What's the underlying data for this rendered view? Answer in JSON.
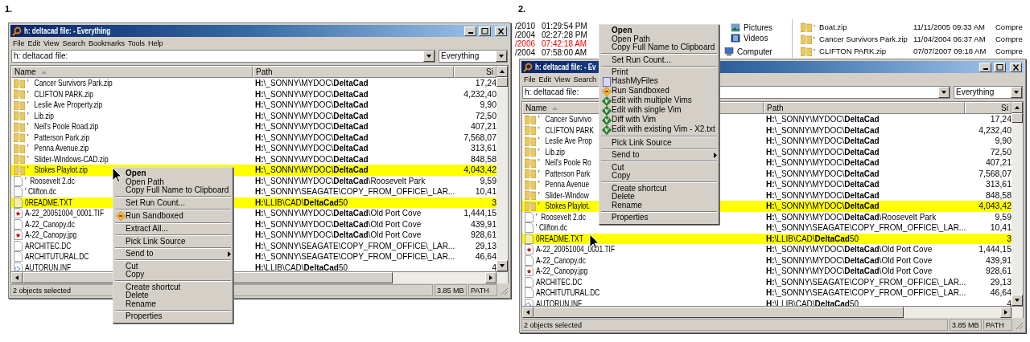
{
  "panels": [
    {
      "label": "1.",
      "window": {
        "title": "h: deltacad file: - Everything",
        "menu": [
          "File",
          "Edit",
          "View",
          "Search",
          "Bookmarks",
          "Tools",
          "Help"
        ],
        "search": {
          "value": "h: deltacad file:"
        },
        "filter": "Everything",
        "columns": [
          "Name",
          "Path",
          "Si"
        ],
        "rows": [
          {
            "kind": "zip",
            "name": "'   Cancer Survivors Park.zip",
            "path": "**H:**\\_SONNY\\MYDOC\\**DeltaCad**",
            "size": "17,24",
            "selected": false
          },
          {
            "kind": "zip",
            "name": "'   CLIFTON PARK.zip",
            "path": "**H:**\\_SONNY\\MYDOC\\**DeltaCad**",
            "size": "4,232,40",
            "selected": false
          },
          {
            "kind": "zip",
            "name": "'   Leslie Ave Property.zip",
            "path": "**H:**\\_SONNY\\MYDOC\\**DeltaCad**",
            "size": "9,90",
            "selected": false
          },
          {
            "kind": "zip",
            "name": "'   Lib.zip",
            "path": "**H:**\\_SONNY\\MYDOC\\**DeltaCad**",
            "size": "72,50",
            "selected": false
          },
          {
            "kind": "zip",
            "name": "'   Neil's Poole Road.zip",
            "path": "**H:**\\_SONNY\\MYDOC\\**DeltaCad**",
            "size": "407,21",
            "selected": false
          },
          {
            "kind": "zip",
            "name": "'   Patterson Park.zip",
            "path": "**H:**\\_SONNY\\MYDOC\\**DeltaCad**",
            "size": "7,568,07",
            "selected": false
          },
          {
            "kind": "zip",
            "name": "'   Penna Avenue.zip",
            "path": "**H:**\\_SONNY\\MYDOC\\**DeltaCad**",
            "size": "313,61",
            "selected": false
          },
          {
            "kind": "zip",
            "name": "'   Slider-Windows-CAD.zip",
            "path": "**H:**\\_SONNY\\MYDOC\\**DeltaCad**",
            "size": "848,58",
            "selected": false
          },
          {
            "kind": "zip",
            "name": "'   Stokes Playlot.zip",
            "path": "**H:**\\_SONNY\\MYDOC\\**DeltaCad**",
            "size": "4,043,42",
            "selected": true
          },
          {
            "kind": "doc",
            "name": "'  Roosevelt 2.dc",
            "path": "**H:**\\_SONNY\\MYDOC\\**DeltaCad**\\Roosevelt Park",
            "size": "9,59",
            "selected": false
          },
          {
            "kind": "doc",
            "name": "' Clifton.dc",
            "path": "**H:**\\_SONNY\\SEAGATE\\COPY_FROM_OFFICE\\_LAR...",
            "size": "10,41",
            "selected": false
          },
          {
            "kind": "text",
            "name": "0README.TXT",
            "path": "**H:**\\LLIB\\CAD\\**DeltaCad**50",
            "size": "3",
            "selected": true
          },
          {
            "kind": "image",
            "name": "A-22_20051004_0001.TIF",
            "path": "**H:**\\_SONNY\\MYDOC\\**DeltaCad**\\Old Port Cove",
            "size": "1,444,15",
            "selected": false
          },
          {
            "kind": "doc",
            "name": "A-22_Canopy.dc",
            "path": "**H:**\\_SONNY\\MYDOC\\**DeltaCad**\\Old Port Cove",
            "size": "439,91",
            "selected": false
          },
          {
            "kind": "image",
            "name": "A-22_Canopy.jpg",
            "path": "**H:**\\_SONNY\\MYDOC\\**DeltaCad**\\Old Port Cove",
            "size": "928,61",
            "selected": false
          },
          {
            "kind": "doc",
            "name": "ARCHITEC.DC",
            "path": "**H:**\\_SONNY\\SEAGATE\\COPY_FROM_OFFICE\\_LAR...",
            "size": "29,13",
            "selected": false
          },
          {
            "kind": "doc",
            "name": "ARCHITUTURAL.DC",
            "path": "**H:**\\_SONNY\\SEAGATE\\COPY_FROM_OFFICE\\_LAR...",
            "size": "46,64",
            "selected": false
          },
          {
            "kind": "settings",
            "name": "AUTORUN.INF",
            "path": "**H:**\\LLIB\\CAD\\**DeltaCad**50",
            "size": "4",
            "selected": false
          }
        ],
        "status": [
          "2 objects selected",
          "3.85 MB",
          "PATH"
        ]
      },
      "context_menu": {
        "groups": [
          [
            {
              "label": "Open",
              "default": true
            },
            {
              "label": "Open Path",
              "default": false
            },
            {
              "label": "Copy Full Name to Clipboard",
              "default": false
            }
          ],
          [
            {
              "label": "Set Run Count...",
              "default": false
            }
          ],
          [
            {
              "label": "Run Sandboxed",
              "default": false,
              "kind": "sandbox"
            }
          ],
          [
            {
              "label": "Extract All...",
              "default": false
            }
          ],
          [
            {
              "label": "Pick Link Source",
              "default": false
            }
          ],
          [
            {
              "label": "Send to",
              "default": false,
              "submenu": true
            }
          ],
          [
            {
              "label": "Cut",
              "default": false
            },
            {
              "label": "Copy",
              "default": false
            }
          ],
          [
            {
              "label": "Create shortcut",
              "default": false
            },
            {
              "label": "Delete",
              "default": false
            },
            {
              "label": "Rename",
              "default": false
            }
          ],
          [
            {
              "label": "Properties",
              "default": false
            }
          ]
        ]
      }
    },
    {
      "label": "2.",
      "background": {
        "dates": [
          {
            "date": "/2010",
            "time": "01:29:54 PM",
            "color": "#000000"
          },
          {
            "date": "/2004",
            "time": "02:27:28 PM",
            "color": "#000000"
          },
          {
            "date": "/2006",
            "time": "07:42:18 AM",
            "color": "#ff0000"
          },
          {
            "date": "/2004",
            "time": "07:58:00 AM",
            "color": "#000000"
          }
        ],
        "places": [
          {
            "kind": "pictures",
            "label": "Pictures"
          },
          {
            "kind": "videos",
            "label": "Videos"
          },
          {
            "kind": "computer",
            "label": "Computer"
          }
        ],
        "files": [
          {
            "name": "'  Boat.zip",
            "date": "11/11/2005 09:33 AM",
            "type": "Compre"
          },
          {
            "name": "'  Cancer Survivors Park.zip",
            "date": "11/04/2004 06:37 AM",
            "type": "Compre"
          },
          {
            "name": "'  CLIFTON PARK.zip",
            "date": "07/07/2007 09:18 AM",
            "type": "Compre"
          }
        ]
      },
      "window": {
        "title": "h: deltacad file: - Ev",
        "menu": [
          "File",
          "Edit",
          "View",
          "Search"
        ],
        "search": {
          "value": "h: deltacad file:"
        },
        "filter": "Everything",
        "columns": [
          "Name",
          "Path",
          "Si"
        ],
        "rows": [
          {
            "kind": "zip",
            "name": "'   Cancer Survivo",
            "path": "**H:**\\_SONNY\\MYDOC\\**DeltaCad**",
            "size": "17,24",
            "selected": false
          },
          {
            "kind": "zip",
            "name": "'   CLIFTON PARK",
            "path": "**H:**\\_SONNY\\MYDOC\\**DeltaCad**",
            "size": "4,232,40",
            "selected": false
          },
          {
            "kind": "zip",
            "name": "'   Leslie Ave Prop",
            "path": "**H:**\\_SONNY\\MYDOC\\**DeltaCad**",
            "size": "9,90",
            "selected": false
          },
          {
            "kind": "zip",
            "name": "'   Lib.zip",
            "path": "**H:**\\_SONNY\\MYDOC\\**DeltaCad**",
            "size": "72,50",
            "selected": false
          },
          {
            "kind": "zip",
            "name": "'   Neil's Poole Ro",
            "path": "**H:**\\_SONNY\\MYDOC\\**DeltaCad**",
            "size": "407,21",
            "selected": false
          },
          {
            "kind": "zip",
            "name": "'   Patterson Park",
            "path": "**H:**\\_SONNY\\MYDOC\\**DeltaCad**",
            "size": "7,568,07",
            "selected": false
          },
          {
            "kind": "zip",
            "name": "'   Penna Avenue",
            "path": "**H:**\\_SONNY\\MYDOC\\**DeltaCad**",
            "size": "313,61",
            "selected": false
          },
          {
            "kind": "zip",
            "name": "'   Slider-Window",
            "path": "**H:**\\_SONNY\\MYDOC\\**DeltaCad**",
            "size": "848,58",
            "selected": false
          },
          {
            "kind": "zip",
            "name": "'   Stokes Playlot.",
            "path": "**H:**\\_SONNY\\MYDOC\\**DeltaCad**",
            "size": "4,043,42",
            "selected": true
          },
          {
            "kind": "doc",
            "name": "'  Roosevelt 2.dc",
            "path": "**H:**\\_SONNY\\MYDOC\\**DeltaCad**\\Roosevelt Park",
            "size": "9,59",
            "selected": false
          },
          {
            "kind": "doc",
            "name": "' Clifton.dc",
            "path": "**H:**\\_SONNY\\SEAGATE\\COPY_FROM_OFFICE\\_LAR...",
            "size": "10,41",
            "selected": false
          },
          {
            "kind": "text",
            "name": "0README.TXT",
            "path": "**H:**\\LLIB\\CAD\\**DeltaCad**50",
            "size": "3",
            "selected": true
          },
          {
            "kind": "image",
            "name": "A-22_20051004_0001.TIF",
            "path": "**H:**\\_SONNY\\MYDOC\\**DeltaCad**\\Old Port Cove",
            "size": "1,444,15",
            "selected": false
          },
          {
            "kind": "doc",
            "name": "A-22_Canopy.dc",
            "path": "**H:**\\_SONNY\\MYDOC\\**DeltaCad**\\Old Port Cove",
            "size": "439,91",
            "selected": false
          },
          {
            "kind": "image",
            "name": "A-22_Canopy.jpg",
            "path": "**H:**\\_SONNY\\MYDOC\\**DeltaCad**\\Old Port Cove",
            "size": "928,61",
            "selected": false
          },
          {
            "kind": "doc",
            "name": "ARCHITEC.DC",
            "path": "**H:**\\_SONNY\\SEAGATE\\COPY_FROM_OFFICE\\_LAR...",
            "size": "29,13",
            "selected": false
          },
          {
            "kind": "doc",
            "name": "ARCHITUTURAL.DC",
            "path": "**H:**\\_SONNY\\SEAGATE\\COPY_FROM_OFFICE\\_LAR...",
            "size": "46,64",
            "selected": false
          },
          {
            "kind": "settings",
            "name": "AUTORUN.INF",
            "path": "**H:**\\LLIB\\CAD\\**DeltaCad**50",
            "size": "4",
            "selected": false
          }
        ],
        "status": [
          "2 objects selected",
          "3.85 MB",
          "PATH"
        ]
      },
      "context_menu": {
        "groups": [
          [
            {
              "label": "Open",
              "default": true
            },
            {
              "label": "Open Path",
              "default": false
            },
            {
              "label": "Copy Full Name to Clipboard",
              "default": false
            }
          ],
          [
            {
              "label": "Set Run Count...",
              "default": false
            }
          ],
          [
            {
              "label": "Print",
              "default": false
            },
            {
              "label": "HashMyFiles",
              "default": false,
              "kind": "page"
            },
            {
              "label": "Run Sandboxed",
              "default": false,
              "kind": "sandbox"
            },
            {
              "label": "Edit with multiple Vims",
              "default": false,
              "kind": "vim"
            },
            {
              "label": "Edit with single Vim",
              "default": false,
              "kind": "vim"
            },
            {
              "label": "Diff with Vim",
              "default": false,
              "kind": "vim"
            },
            {
              "label": "Edit with existing Vim - X2.txt",
              "default": false,
              "kind": "vim"
            }
          ],
          [
            {
              "label": "Pick Link Source",
              "default": false
            }
          ],
          [
            {
              "label": "Send to",
              "default": false,
              "submenu": true
            }
          ],
          [
            {
              "label": "Cut",
              "default": false
            },
            {
              "label": "Copy",
              "default": false
            }
          ],
          [
            {
              "label": "Create shortcut",
              "default": false
            },
            {
              "label": "Delete",
              "default": false
            },
            {
              "label": "Rename",
              "default": false
            }
          ],
          [
            {
              "label": "Properties",
              "default": false
            }
          ]
        ]
      }
    }
  ]
}
